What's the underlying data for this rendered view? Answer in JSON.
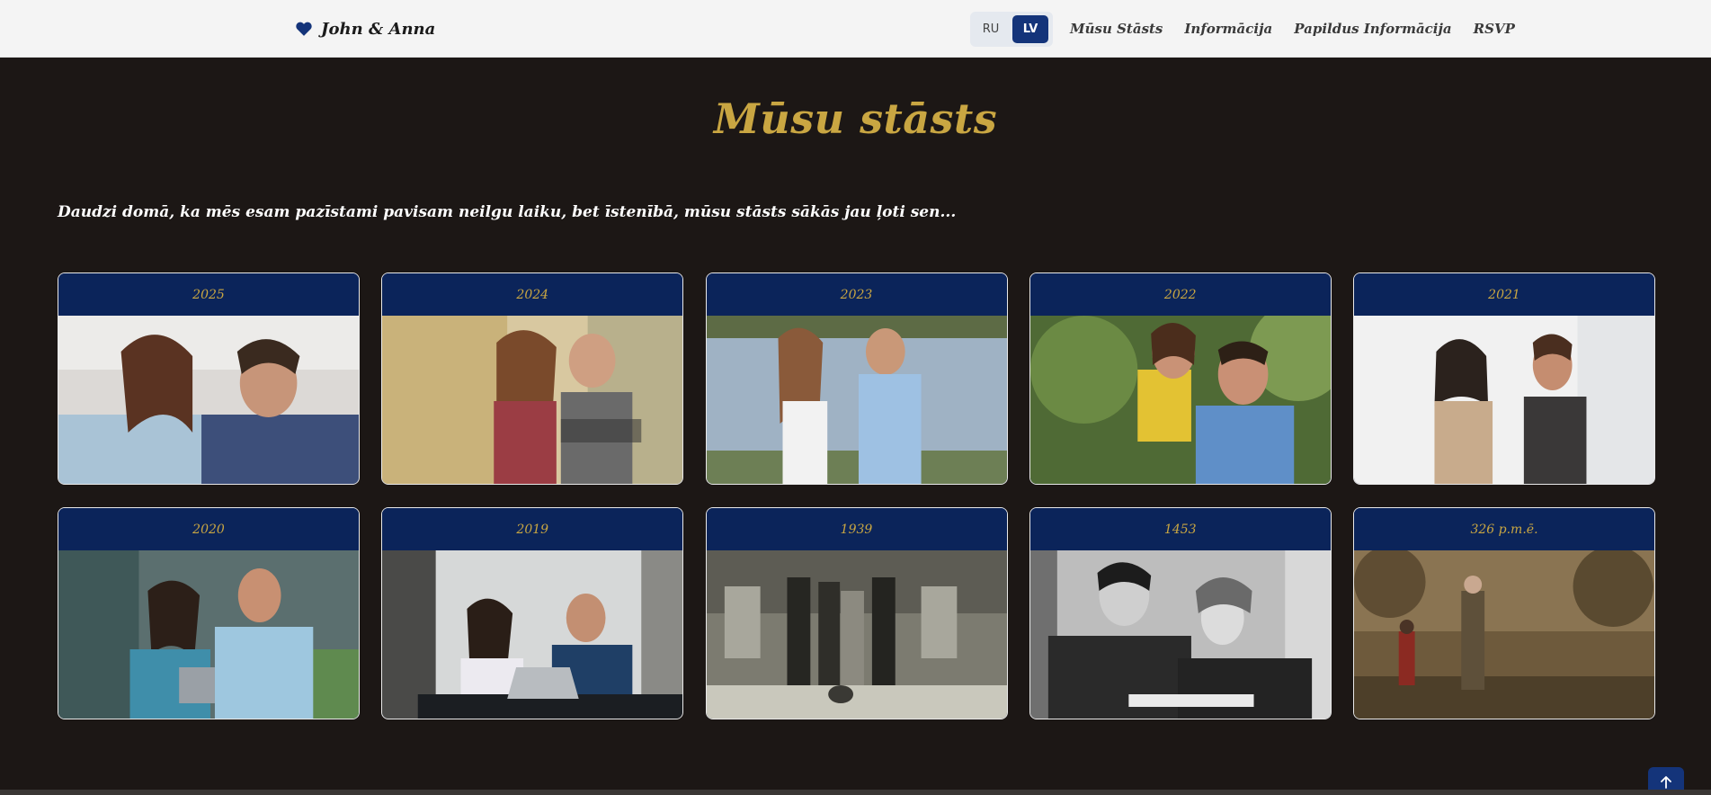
{
  "nav": {
    "brand": "John & Anna",
    "languages": [
      {
        "label": "RU",
        "active": false
      },
      {
        "label": "LV",
        "active": true
      }
    ],
    "links": [
      "Mūsu Stāsts",
      "Informācija",
      "Papildus Informācija",
      "RSVP"
    ]
  },
  "main": {
    "title": "Mūsu stāsts",
    "intro": "Daudzi domā, ka mēs esam pazīstami pavisam neilgu laiku, bet īstenībā, mūsu stāsts sākās jau ļoti sen..."
  },
  "timeline": [
    {
      "year": "2025",
      "photo": "couple-laughing-closeup"
    },
    {
      "year": "2024",
      "photo": "couple-embracing-outdoors"
    },
    {
      "year": "2023",
      "photo": "couple-by-lake"
    },
    {
      "year": "2022",
      "photo": "piggyback-couple"
    },
    {
      "year": "2021",
      "photo": "couple-walking-coffee"
    },
    {
      "year": "2020",
      "photo": "couple-with-tablet"
    },
    {
      "year": "2019",
      "photo": "couple-at-laptop"
    },
    {
      "year": "1939",
      "photo": "vintage-family-photo"
    },
    {
      "year": "1453",
      "photo": "vintage-couple-reading"
    },
    {
      "year": "326 p.m.ē.",
      "photo": "painting-hunters-landscape"
    }
  ],
  "colors": {
    "background": "#1c1715",
    "navbar": "#f4f4f4",
    "accent_gold": "#c9a642",
    "card_header": "#0b245a",
    "button_blue": "#14347a"
  },
  "icons": {
    "brand": "heart-icon",
    "back_to_top": "arrow-up-icon"
  }
}
